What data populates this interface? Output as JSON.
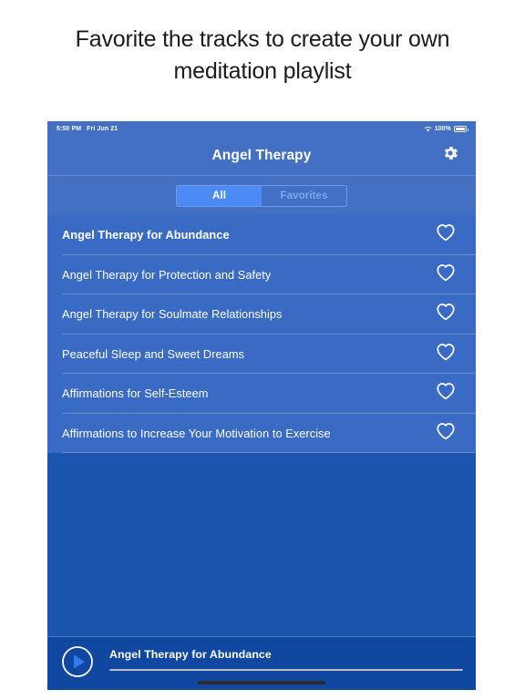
{
  "promo": {
    "headline": "Favorite the tracks to create your own meditation playlist"
  },
  "colors": {
    "page_background": "#ffffff",
    "header_blue": "#4470c4",
    "list_background": "#1b55ad",
    "row_blue": "#3a6bc4",
    "segment_active": "#4c8bf5",
    "segment_inactive_text": "#79a4ee",
    "player_bar": "#0f47a1",
    "text_white": "#ffffff"
  },
  "status_bar": {
    "time": "5:50 PM",
    "date": "Fri Jun 21",
    "wifi_icon": "wifi-icon",
    "battery_percent": "100%",
    "battery_icon": "battery-icon"
  },
  "header": {
    "title": "Angel Therapy",
    "settings_icon": "gear-icon"
  },
  "segmented_control": {
    "options": [
      {
        "label": "All",
        "selected": true
      },
      {
        "label": "Favorites",
        "selected": false
      }
    ]
  },
  "tracks": [
    {
      "title": "Angel Therapy for Abundance",
      "playing": true,
      "favorite_icon": "heart-outline-icon"
    },
    {
      "title": "Angel Therapy for Protection and Safety",
      "playing": false,
      "favorite_icon": "heart-outline-icon"
    },
    {
      "title": "Angel Therapy for Soulmate Relationships",
      "playing": false,
      "favorite_icon": "heart-outline-icon"
    },
    {
      "title": "Peaceful Sleep and Sweet Dreams",
      "playing": false,
      "favorite_icon": "heart-outline-icon"
    },
    {
      "title": "Affirmations for Self-Esteem",
      "playing": false,
      "favorite_icon": "heart-outline-icon"
    },
    {
      "title": "Affirmations to Increase Your Motivation to Exercise",
      "playing": false,
      "favorite_icon": "heart-outline-icon"
    }
  ],
  "player": {
    "play_icon": "play-circle-icon",
    "now_playing_title": "Angel Therapy for Abundance",
    "progress_percent": 0
  }
}
